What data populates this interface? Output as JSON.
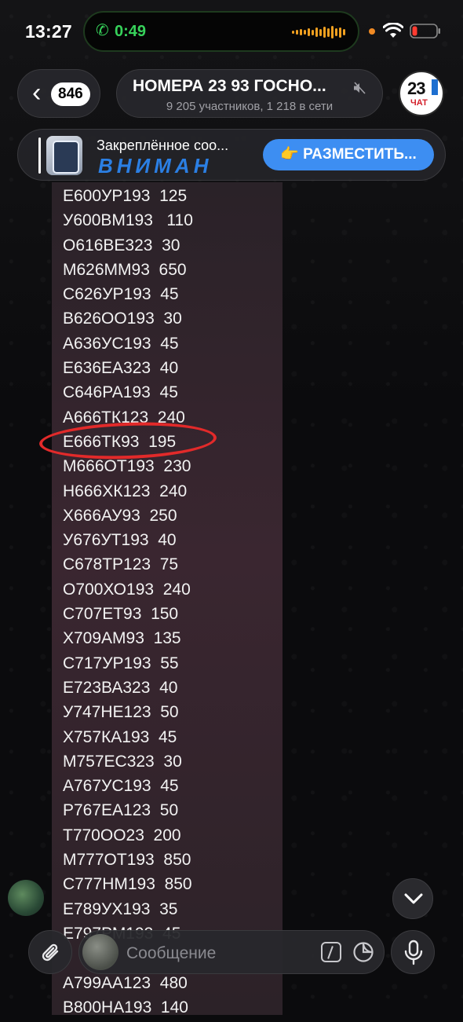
{
  "status": {
    "time": "13:27",
    "call_timer": "0:49"
  },
  "header": {
    "back_count": "846",
    "chat_title": "НОМЕРА 23 93 ГОСНО...",
    "chat_subtitle": "9 205 участников, 1 218 в сети",
    "avatar_number": "23",
    "avatar_label": "ЧАТ"
  },
  "pinned": {
    "label": "Закреплённое соо...",
    "text": "ВНИМАН",
    "button_label": "👉 РАЗМЕСТИТЬ..."
  },
  "message": {
    "rows": [
      "Е600УР193  125",
      "У600ВМ193   110",
      "О616ВЕ323  30",
      "М626ММ93  650",
      "С626УР193  45",
      "В626ОО193  30",
      "А636УС193  45",
      "Е636ЕА323  40",
      "С646РА193  45",
      "А666ТК123  240",
      "Е666ТК93  195",
      "М666ОТ193  230",
      "Н666ХК123  240",
      "Х666АУ93  250",
      "У676УТ193  40",
      "С678ТР123  75",
      "О700ХО193  240",
      "С707ЕТ93  150",
      "Х709АМ93  135",
      "С717УР193  55",
      "Е723ВА323  40",
      "У747НЕ123  50",
      "Х757КА193  45",
      "М757ЕС323  30",
      "А767УС193  45",
      "Р767ЕА123  50",
      "Т770ОО23  200",
      "М777ОТ193  850",
      "С777НМ193  850",
      "Е789УХ193  35",
      "Е797РМ193  45",
      "",
      "А799АА123  480",
      "В800НА193  140"
    ],
    "highlighted_row": "Е666ТК93  195"
  },
  "composer": {
    "placeholder": "Сообщение"
  },
  "colors": {
    "accent": "#3d8ef2",
    "call_green": "#37d35b",
    "highlight_red": "#e22a2a"
  }
}
